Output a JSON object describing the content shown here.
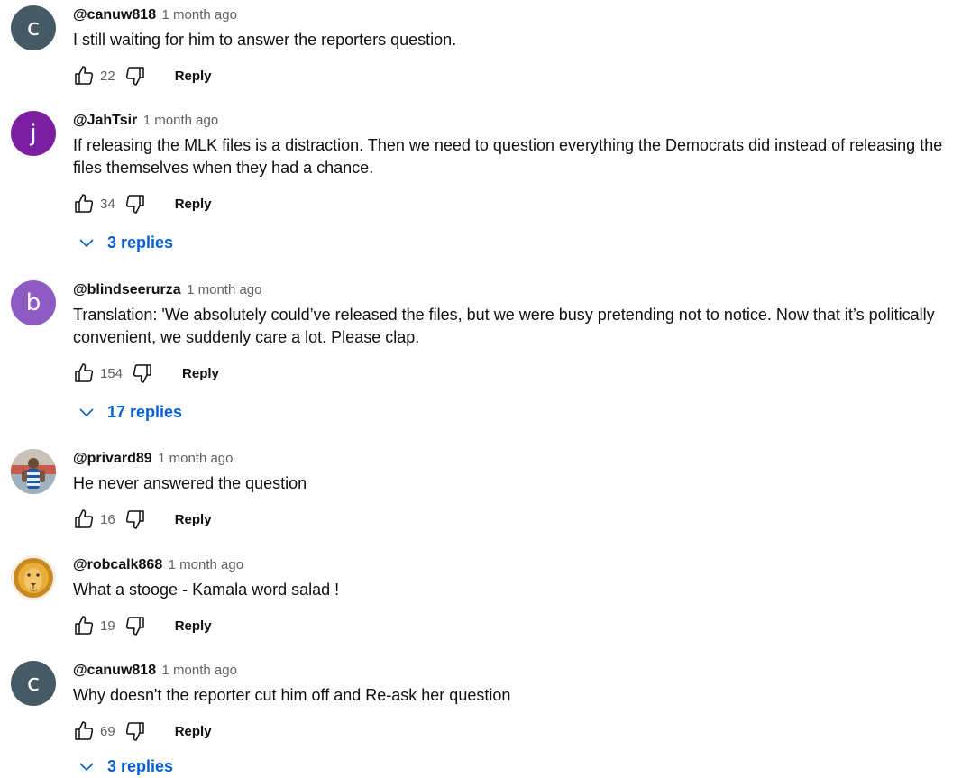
{
  "comments": [
    {
      "author": "@canuw818",
      "time": "1 month ago",
      "text": "I still waiting for him to answer the reporters question.",
      "likes": "22",
      "reply_label": "Reply",
      "avatar_letter": "c",
      "avatar_color": "#455a64"
    },
    {
      "author": "@JahTsir",
      "time": "1 month ago",
      "text": "If releasing the MLK files is a distraction. Then we need to question everything the Democrats did instead of releasing the files themselves when they had a chance.",
      "likes": "34",
      "reply_label": "Reply",
      "avatar_letter": "j",
      "avatar_color": "#7b1fa2",
      "replies_label": "3 replies"
    },
    {
      "author": "@blindseerurza",
      "time": "1 month ago",
      "text": "Translation: 'We absolutely could’ve released the files, but we were busy pretending not to notice. Now that it’s politically convenient, we suddenly care a lot. Please clap.",
      "likes": "154",
      "reply_label": "Reply",
      "avatar_letter": "b",
      "avatar_color": "#8e5bc2",
      "replies_label": "17 replies"
    },
    {
      "author": "@privard89",
      "time": "1 month ago",
      "text": "He never answered the question",
      "likes": "16",
      "reply_label": "Reply",
      "avatar_type": "photo"
    },
    {
      "author": "@robcalk868",
      "time": "1 month ago",
      "text": "What a stooge - Kamala word salad !",
      "likes": "19",
      "reply_label": "Reply",
      "avatar_type": "lion"
    },
    {
      "author": "@canuw818",
      "time": "1 month ago",
      "text": "Why doesn't the reporter cut him off and Re-ask her question",
      "likes": "69",
      "reply_label": "Reply",
      "avatar_letter": "c",
      "avatar_color": "#455a64",
      "replies_label": "3 replies"
    }
  ]
}
